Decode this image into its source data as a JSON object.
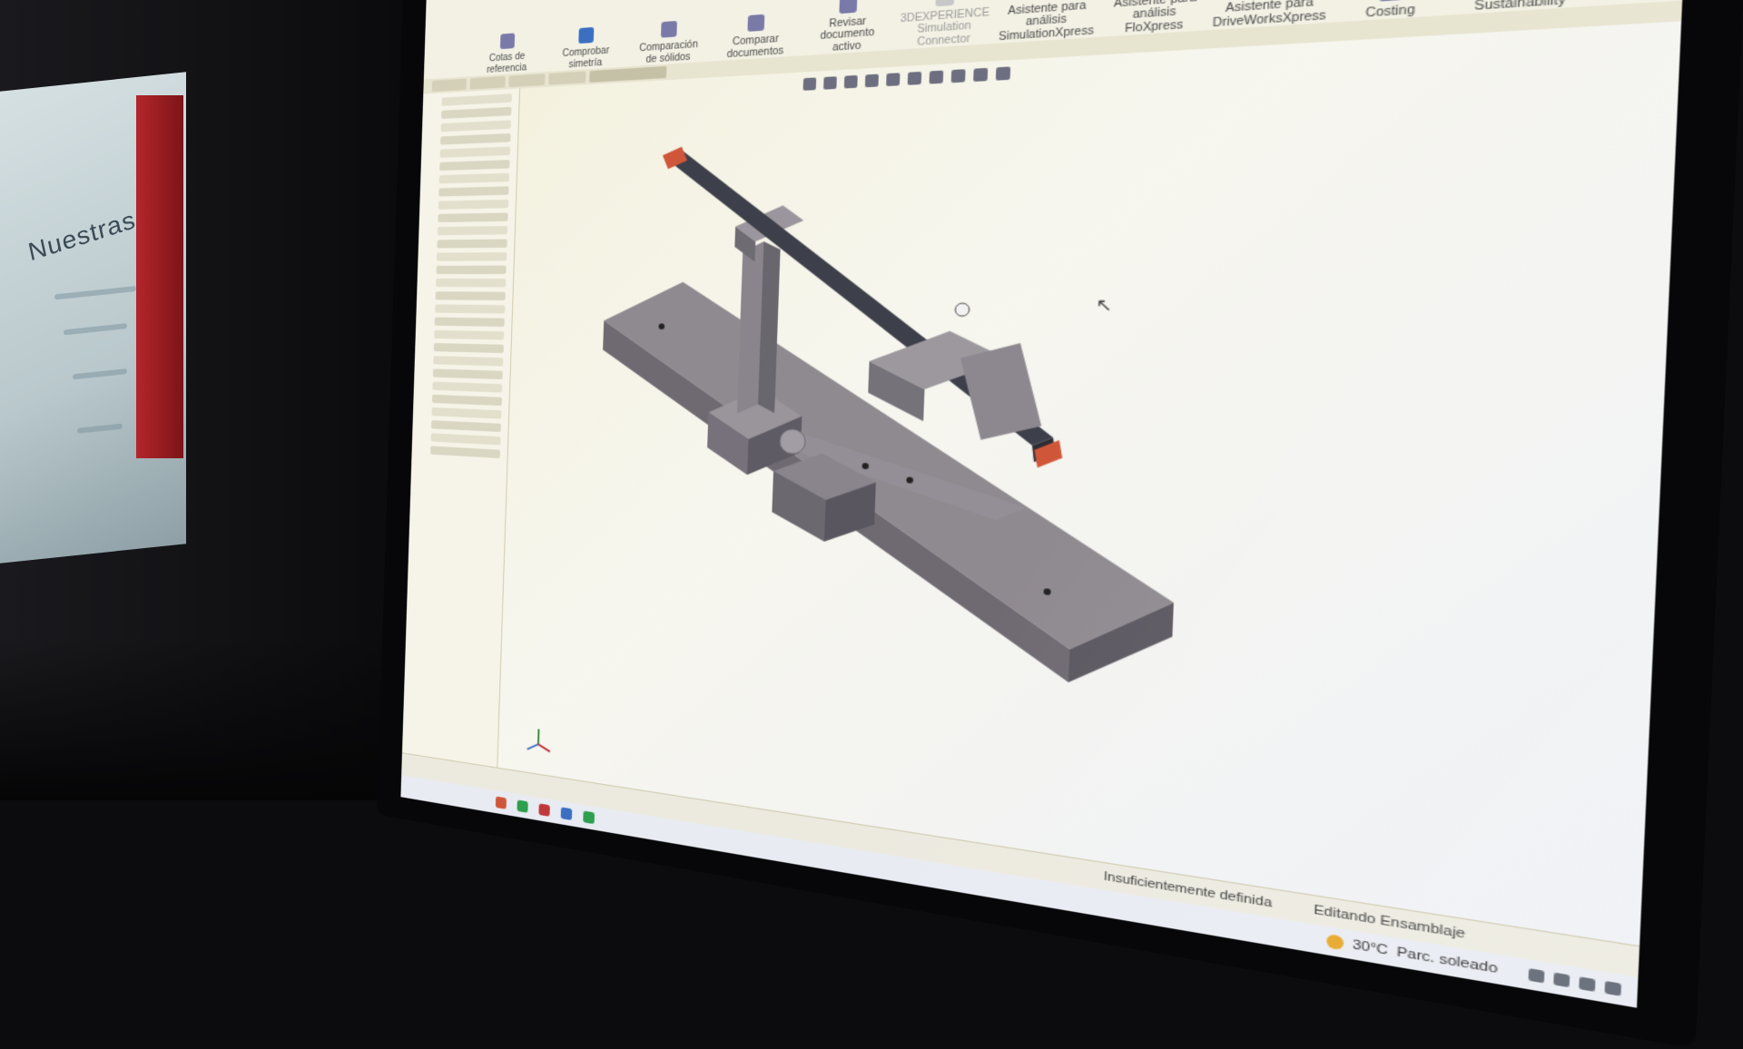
{
  "background": {
    "book_title": "Nuestras E"
  },
  "ribbon": {
    "items": [
      {
        "label": "Cotas de referencia",
        "icon": "dimension-icon",
        "dim": false
      },
      {
        "label": "Comprobar simetría",
        "icon": "symmetry-icon",
        "dim": false
      },
      {
        "label": "Comparación de sólidos",
        "icon": "compare-icon",
        "dim": false
      },
      {
        "label": "Comparar documentos",
        "icon": "documents-icon",
        "dim": false
      },
      {
        "label": "Revisar documento activo",
        "icon": "review-icon",
        "dim": false
      },
      {
        "label": "3DEXPERIENCE Simulation Connector",
        "icon": "simulation-icon",
        "dim": true
      },
      {
        "label": "Asistente para análisis SimulationXpress",
        "icon": "simulationxpress-icon",
        "dim": false
      },
      {
        "label": "Asistente para análisis FloXpress",
        "icon": "floxpress-icon",
        "dim": false
      },
      {
        "label": "Asistente para DriveWorksXpress",
        "icon": "driveworks-icon",
        "dim": false
      },
      {
        "label": "Costing",
        "icon": "costing-icon",
        "dim": false
      },
      {
        "label": "Sustainability",
        "icon": "sustainability-icon",
        "dim": false
      }
    ]
  },
  "status": {
    "definition": "Insuficientemente definida",
    "mode": "Editando Ensamblaje"
  },
  "taskbar": {
    "temperature": "30°C",
    "weather": "Parc. soleado"
  },
  "colors": {
    "viewport": "#f4f2e6",
    "part_gray": "#8f8a90",
    "bar_dark": "#3d3f4a",
    "bar_tip": "#d0563a"
  }
}
